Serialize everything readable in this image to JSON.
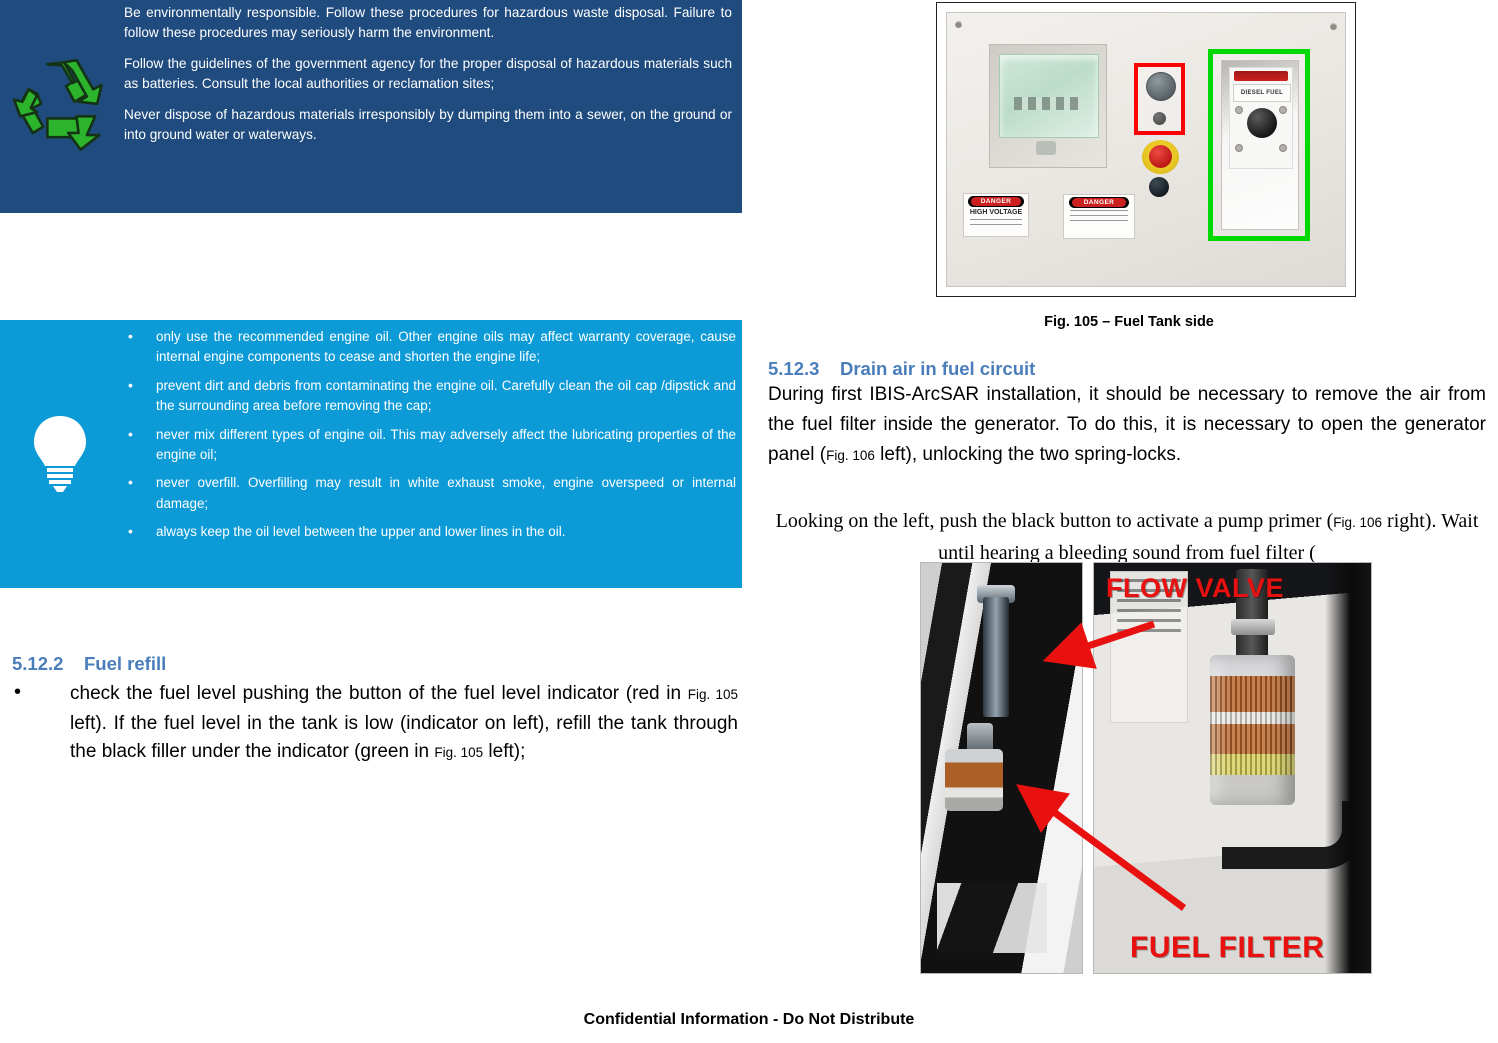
{
  "environmental_callout": {
    "icon": "recycle-icon",
    "background_color": "#1F4B7E",
    "paragraphs": [
      "Be environmentally responsible. Follow these procedures for hazardous waste disposal. Failure to follow these procedures may seriously harm the environment.",
      "Follow the guidelines of the government agency for the proper disposal of hazardous materials such as batteries. Consult the local authorities or reclamation sites;",
      "Never dispose of hazardous materials irresponsibly by dumping them into a sewer, on the ground or into ground water or waterways."
    ]
  },
  "tip_callout": {
    "icon": "lightbulb-icon",
    "background_color": "#0D9BD7",
    "items": [
      "only use the recommended engine oil. Other engine oils may affect warranty coverage, cause internal engine components to cease and shorten the engine life;",
      "prevent dirt and debris from contaminating the engine oil. Carefully clean the oil cap /dipstick and the surrounding area before removing the cap;",
      "never mix different types of engine oil. This may adversely affect the lubricating properties of the engine oil;",
      "never overfill. Overfilling may result in white exhaust smoke, engine overspeed or internal damage;",
      "always keep the oil level between the upper and lower lines in the oil."
    ]
  },
  "section_fuel_refill": {
    "number": "5.12.2",
    "title": "Fuel refill",
    "heading_color": "#4A7EBB",
    "bullet": {
      "part1": "check the fuel level pushing the button of the fuel level indicator (red in ",
      "ref1": "Fig. 105",
      "part2": " left). If the fuel level in the tank is low (indicator on left), refill the tank through the black filler under the indicator (green in ",
      "ref2": "Fig. 105",
      "part3": " left);"
    }
  },
  "figure_105": {
    "caption": "Fig. 105 – Fuel Tank side",
    "alt": "generator control panel photo",
    "highlights": [
      {
        "name": "fuel-level-indicator-highlight",
        "color": "#FF0000"
      },
      {
        "name": "fuel-filler-highlight",
        "color": "#00D800"
      }
    ],
    "panel_labels": {
      "danger_word": "DANGER",
      "high_voltage": "HIGH VOLTAGE",
      "diesel_fuel": "DIESEL FUEL"
    }
  },
  "section_drain_air": {
    "number": "5.12.3",
    "title": "Drain air in fuel circuit",
    "heading_color": "#4A7EBB",
    "paragraph": {
      "part1": "During first IBIS-ArcSAR installation, it should be necessary to remove the air from the fuel filter inside the generator. To do this, it is necessary to open the generator panel (",
      "ref1": "Fig. 106",
      "part2": " left), unlocking the two spring-locks."
    },
    "paragraph_serif": {
      "part1": "Looking on the left, push the black button to activate a pump primer (",
      "ref1": "Fig. 106",
      "part2": " right). Wait until hearing a bleeding sound from fuel filter ("
    }
  },
  "figure_106": {
    "alt": "fuel filter and flow valve photos",
    "overlay_labels": {
      "flow_valve": "FLOW VALVE",
      "fuel_filter": "FUEL FILTER"
    },
    "arrow_color": "#E8110F"
  },
  "footer": {
    "text": "Confidential Information - Do Not Distribute"
  }
}
